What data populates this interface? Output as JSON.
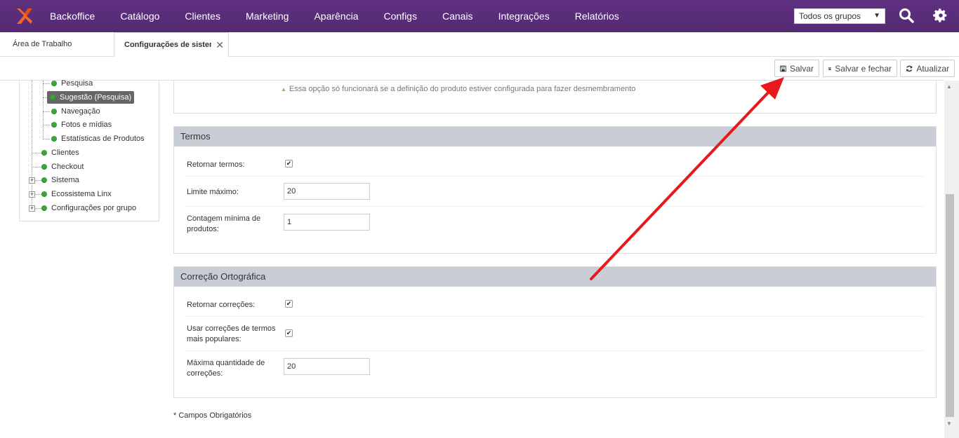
{
  "nav": {
    "items": [
      "Backoffice",
      "Catálogo",
      "Clientes",
      "Marketing",
      "Aparência",
      "Configs",
      "Canais",
      "Integrações",
      "Relatórios"
    ],
    "group_select": "Todos os grupos",
    "search_icon": "search-icon",
    "settings_icon": "gear-icon",
    "brand_color": "#5a2d7a"
  },
  "tabs": {
    "home": "Área de Trabalho",
    "active": "Configurações de sistema",
    "close": "✕"
  },
  "toolbar": {
    "save": "Salvar",
    "save_close": "Salvar e fechar",
    "refresh": "Atualizar"
  },
  "tree": {
    "items": [
      {
        "label": "Pesquisa"
      },
      {
        "label": "Sugestão (Pesquisa)"
      },
      {
        "label": "Navegação"
      },
      {
        "label": "Fotos e mídias"
      },
      {
        "label": "Estatísticas de Produtos"
      },
      {
        "label": "Clientes"
      },
      {
        "label": "Checkout"
      },
      {
        "label": "Sistema"
      },
      {
        "label": "Ecossistema Linx"
      },
      {
        "label": "Configurações por grupo"
      }
    ]
  },
  "hint": "Essa opção só funcionará se a definição do produto estiver configurada para fazer desmembramento",
  "termos": {
    "title": "Termos",
    "retornar_label": "Retornar termos:",
    "retornar_checked": true,
    "limite_label": "Limite máximo:",
    "limite_value": "20",
    "contagem_label": "Contagem mínima de produtos:",
    "contagem_value": "1"
  },
  "correcao": {
    "title": "Correção Ortográfica",
    "retornar_label": "Retornar correções:",
    "retornar_checked": true,
    "usar_label": "Usar correções de termos mais populares:",
    "usar_checked": true,
    "maxima_label": "Máxima quantidade de correções:",
    "maxima_value": "20"
  },
  "footnote": "* Campos Obrigatórios",
  "annotation_color": "#e8191b"
}
